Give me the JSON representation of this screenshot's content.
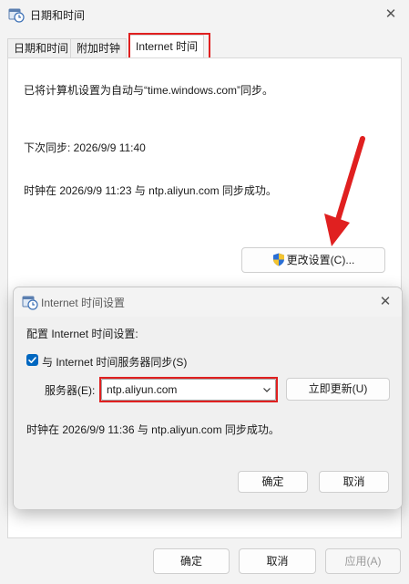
{
  "window": {
    "title": "日期和时间",
    "close_glyph": "✕"
  },
  "tabs": [
    {
      "label": "日期和时间",
      "active": false
    },
    {
      "label": "附加时钟",
      "active": false
    },
    {
      "label": "Internet 时间",
      "active": true
    }
  ],
  "panel": {
    "sync_target_text": "已将计算机设置为自动与“time.windows.com”同步。",
    "next_sync_text": "下次同步: 2026/9/9 11:40",
    "last_sync_text": "时钟在 2026/9/9 11:23 与 ntp.aliyun.com 同步成功。",
    "change_settings_label": "更改设置(C)..."
  },
  "footer": {
    "ok_label": "确定",
    "cancel_label": "取消",
    "apply_label": "应用(A)"
  },
  "dialog": {
    "title": "Internet 时间设置",
    "close_glyph": "✕",
    "config_label": "配置 Internet 时间设置:",
    "sync_checkbox_label": "与 Internet 时间服务器同步(S)",
    "sync_checked": true,
    "server_label": "服务器(E):",
    "server_value": "ntp.aliyun.com",
    "update_now_label": "立即更新(U)",
    "status_text": "时钟在 2026/9/9 11:36 与 ntp.aliyun.com 同步成功。",
    "ok_label": "确定",
    "cancel_label": "取消"
  },
  "colors": {
    "highlight_red": "#e02020",
    "accent_blue": "#0067c0"
  }
}
